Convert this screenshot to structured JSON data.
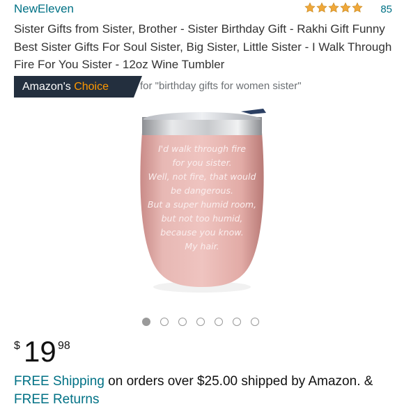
{
  "brand": {
    "name": "NewEleven",
    "rating_stars": 5,
    "rating_count": "85",
    "star_color": "#f0a83a"
  },
  "product": {
    "title": "Sister Gifts from Sister, Brother - Sister Birthday Gift - Rakhi Gift Funny Best Sister Gifts For Soul Sister, Big Sister, Little Sister - I Walk Through Fire For You Sister - 12oz Wine Tumbler"
  },
  "badge": {
    "prefix": "Amazon's",
    "highlight": "Choice",
    "context": "for \"birthday gifts for women sister\"",
    "bg_color": "#232f3e",
    "highlight_color": "#ff9900"
  },
  "image": {
    "tumbler_lines": [
      "I'd walk through fire",
      "for you sister.",
      "Well, not fire, that would",
      "be dangerous.",
      "But a super humid room,",
      "but not too humid,",
      "because you know.",
      "My hair."
    ],
    "tumbler_color": "#e6b1ad",
    "carousel_count": 7,
    "carousel_active": 1
  },
  "price": {
    "currency": "$",
    "whole": "19",
    "fraction": "98"
  },
  "shipping": {
    "free_shipping_link": "FREE Shipping",
    "middle_text": " on orders over $25.00 shipped by Amazon. & ",
    "free_returns_link": "FREE Returns"
  }
}
